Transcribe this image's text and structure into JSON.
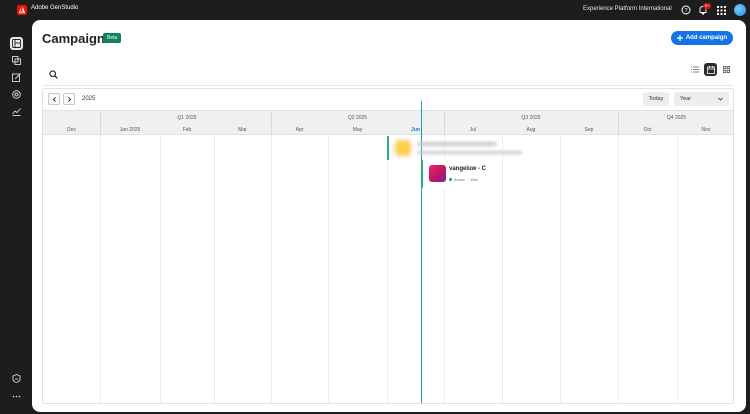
{
  "topbar": {
    "app_name": "Adobe GenStudio",
    "org_name": "Experience Platform International",
    "notification_count": "9+"
  },
  "sidebar": {
    "items": [
      {
        "name": "sidebar-item-overview",
        "icon": "layout-icon",
        "active": true
      },
      {
        "name": "sidebar-item-content",
        "icon": "copy-icon",
        "active": false
      },
      {
        "name": "sidebar-item-create",
        "icon": "edit-icon",
        "active": false
      },
      {
        "name": "sidebar-item-activate",
        "icon": "target-icon",
        "active": false
      },
      {
        "name": "sidebar-item-insights",
        "icon": "chart-icon",
        "active": false
      }
    ],
    "bottom_items": [
      {
        "name": "sidebar-item-brands",
        "icon": "shield-icon"
      },
      {
        "name": "sidebar-item-more",
        "icon": "more-icon"
      }
    ]
  },
  "page": {
    "title": "Campaigns",
    "badge": "Beta",
    "add_button": "Add campaign"
  },
  "calendar": {
    "year": "2025",
    "today_button": "Today",
    "view_select": "Year",
    "quarters": [
      {
        "label": "Q1 2025"
      },
      {
        "label": "Q2 2025"
      },
      {
        "label": "Q3 2025"
      },
      {
        "label": "Q4 2025"
      }
    ],
    "months": [
      "Dec",
      "Jan 2025",
      "Feb",
      "Mar",
      "Apr",
      "May",
      "Jun",
      "Jul",
      "Aug",
      "Sep",
      "Oct",
      "Nov"
    ],
    "current_month": "Jun"
  },
  "campaigns": [
    {
      "name": "vangeluw - C",
      "status": "Active",
      "channel": "Web",
      "color": "#2ab07c"
    }
  ],
  "colors": {
    "accent": "#1473e6",
    "beta": "#12805c",
    "today_line": "#1ba3b8",
    "active_status": "#2d9d78"
  }
}
